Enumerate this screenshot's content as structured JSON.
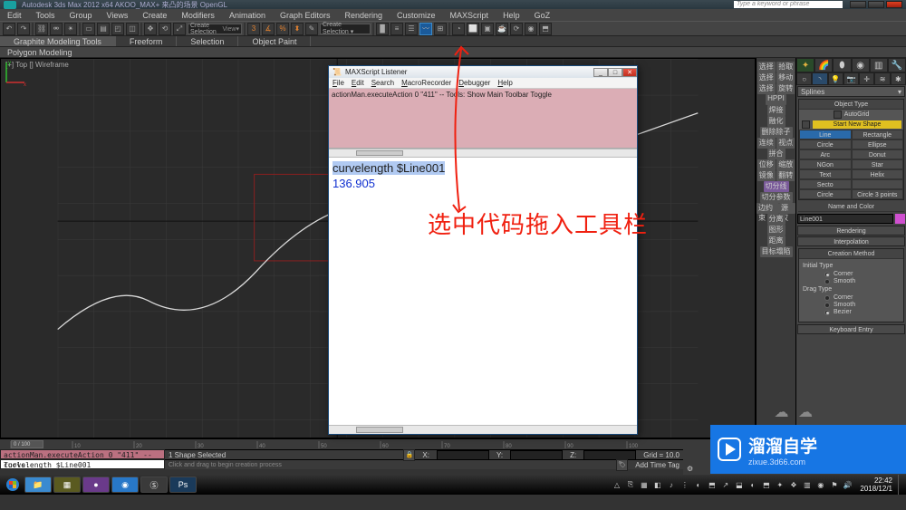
{
  "titlebar": {
    "product": "Autodesk 3ds Max 2012 x64    AKOO_MAX+    来凸的场景    OpenGL",
    "search_placeholder": "Type a keyword or phrase"
  },
  "menubar": [
    "Edit",
    "Tools",
    "Group",
    "Views",
    "Create",
    "Modifiers",
    "Animation",
    "Graph Editors",
    "Rendering",
    "Customize",
    "MAXScript",
    "Help",
    "GoZ"
  ],
  "createSelection": "Create Selection",
  "ribbon": [
    "Graphite Modeling Tools",
    "Freeform",
    "Selection",
    "Object Paint"
  ],
  "sub_ribbon": "Polygon Modeling",
  "viewport": {
    "label": "[+] Top [] Wireframe"
  },
  "sidestrip_rows": [
    [
      "选择",
      "拾取"
    ],
    [
      "选择",
      "移动"
    ],
    [
      "选择",
      "旋转"
    ],
    [
      "",
      "HPPI"
    ],
    [
      "",
      "焊接"
    ],
    [
      "",
      "融化"
    ],
    [
      "删除除子",
      "",
      ""
    ],
    [
      "连续",
      "视点"
    ],
    [
      "拼合",
      "",
      ""
    ],
    [
      "位移",
      "缩放"
    ],
    [
      "镜像",
      "翻转"
    ],
    [
      "切分线",
      "",
      ""
    ],
    [
      "切分参数",
      "",
      ""
    ],
    [
      "边约束",
      "源权"
    ],
    [
      "分离",
      ""
    ],
    [
      "图形",
      ""
    ],
    [
      "距离",
      ""
    ],
    [
      "目标塌陷",
      ""
    ]
  ],
  "cmdpanel": {
    "dropdown": "Splines",
    "rollouts": {
      "objtype": "Object Type",
      "autogrid": "AutoGrid",
      "newshape": "Start New Shape",
      "shapes": [
        [
          "Line",
          "Rectangle"
        ],
        [
          "Circle",
          "Ellipse"
        ],
        [
          "Arc",
          "Donut"
        ],
        [
          "NGon",
          "Star"
        ],
        [
          "Text",
          "Helix"
        ],
        [
          "Secto",
          ""
        ],
        [
          "Circle",
          "Circle 3 points"
        ]
      ],
      "namecolor": "Name and Color",
      "name_value": "Line001",
      "rendering": "Rendering",
      "interpolation": "Interpolation",
      "creation": "Creation Method",
      "initial": "Initial Type",
      "init_opts": [
        "Corner",
        "Smooth"
      ],
      "drag": "Drag Type",
      "drag_opts": [
        "Corner",
        "Smooth",
        "Bezier"
      ],
      "keyboard": "Keyboard Entry"
    }
  },
  "macro_pink": "actionMan.executeAction 0 \"411\"  -- Tools:",
  "mini_listener": "curvelength $Line001",
  "status": {
    "selected": "1 Shape Selected",
    "prompt": "Click and drag to begin creation process",
    "x": "X:",
    "y": "Y:",
    "z": "Z:",
    "grid": "Grid = 10.0",
    "timetag": "Add Time Tag",
    "frame0": "0",
    "frame_last": "100"
  },
  "timeline": {
    "handle": "0 / 100",
    "range": [
      0,
      100
    ],
    "majors": [
      0,
      10,
      20,
      30,
      40,
      50,
      60,
      70,
      80,
      90,
      100
    ]
  },
  "listener": {
    "title": "MAXScript Listener",
    "menu": [
      "File",
      "Edit",
      "Search",
      "MacroRecorder",
      "Debugger",
      "Help"
    ],
    "top_line": "actionMan.executeAction 0 \"411\"  -- Tools: Show Main Toolbar Toggle",
    "body_line1": "curvelength $Line001",
    "body_line2": "136.905"
  },
  "annotation": "选中代码拖入工具栏",
  "watermark": {
    "text": "溜溜自学",
    "url": "zixue.3d66.com"
  },
  "taskbar": {
    "tray_icons": [
      "△",
      "⎘",
      "▦",
      "◧",
      "♪",
      "⋮",
      "◐",
      "⬒",
      "↗",
      "⬓",
      "◐",
      "⬒",
      "✦",
      "❖",
      "▥",
      "◉",
      "⚑",
      "🔊"
    ],
    "time": "22:42",
    "date": "2018/12/1"
  }
}
